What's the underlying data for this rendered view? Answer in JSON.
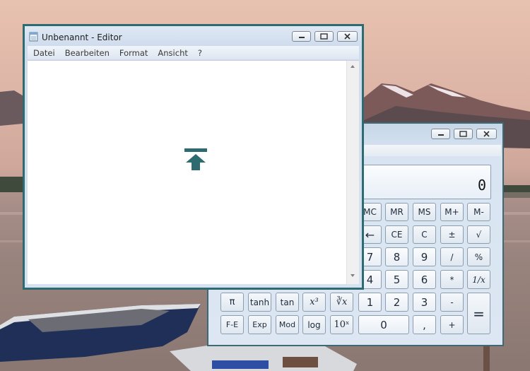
{
  "notepad": {
    "title": "Unbenannt - Editor",
    "menu": [
      "Datei",
      "Bearbeiten",
      "Format",
      "Ansicht",
      "?"
    ],
    "text": "",
    "title_bar_buttons": [
      "minimize-icon",
      "maximize-icon",
      "close-icon"
    ],
    "center_icon": "pin-top-icon"
  },
  "calculator": {
    "display": "0",
    "title_bar_buttons": [
      "minimize-icon",
      "maximize-icon",
      "close-icon"
    ],
    "buttons": {
      "mc": "MC",
      "mr": "MR",
      "ms": "MS",
      "mplus": "M+",
      "mminus": "M-",
      "backspace": "←",
      "ce": "CE",
      "c": "C",
      "plusminus": "±",
      "sqrt": "√",
      "seven": "7",
      "eight": "8",
      "nine": "9",
      "divide": "/",
      "percent": "%",
      "four": "4",
      "five": "5",
      "six": "6",
      "multiply": "*",
      "reciprocal": "1/x",
      "pi": "π",
      "tanh": "tanh",
      "tan": "tan",
      "cube": "x³",
      "cuberoot": "∛x",
      "one": "1",
      "two": "2",
      "three": "3",
      "minus": "-",
      "equals": "=",
      "fe": "F-E",
      "exp": "Exp",
      "mod": "Mod",
      "log": "log",
      "tenpow": "10ˣ",
      "zero": "0",
      "decimal": ",",
      "plus": "+"
    }
  },
  "colors": {
    "window_frame": "#2e6b70",
    "calc_frame": "#3e6874",
    "accent": "#2e6b70"
  }
}
